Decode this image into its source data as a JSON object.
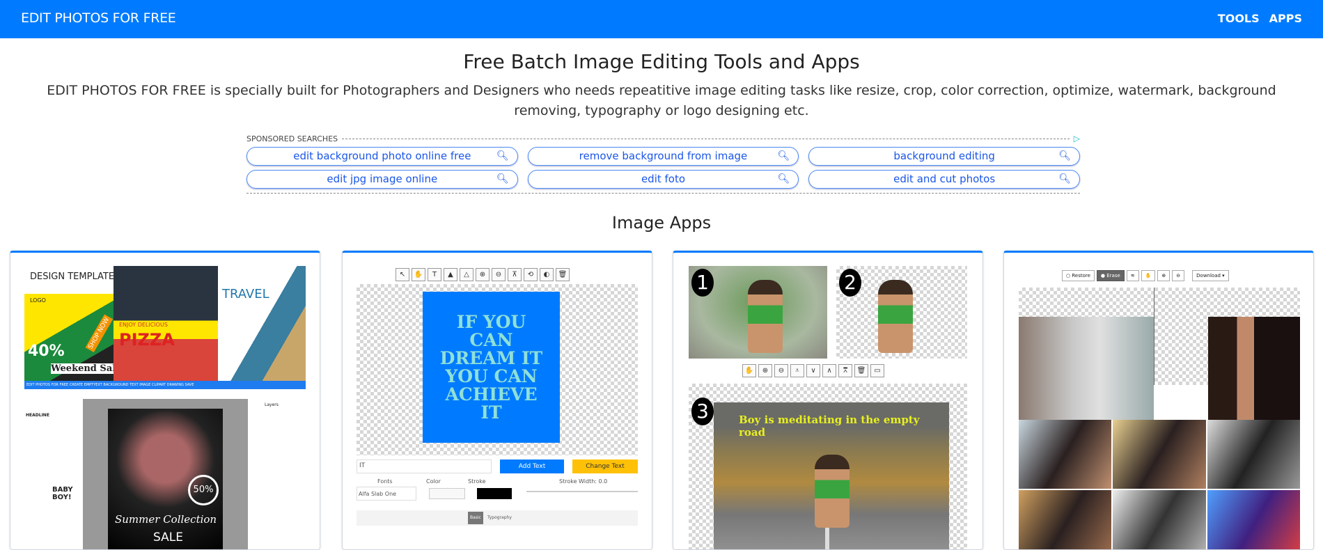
{
  "nav": {
    "brand": "EDIT PHOTOS FOR FREE",
    "links": [
      "TOOLS",
      "APPS"
    ]
  },
  "page": {
    "title": "Free Batch Image Editing Tools and Apps",
    "description": "EDIT PHOTOS FOR FREE is specially built for Photographers and Designers who needs repeatitive image editing tasks like resize, crop, color correction, optimize, watermark, background removing, typography or logo designing etc."
  },
  "ads": {
    "label": "SPONSORED SEARCHES",
    "items": [
      "edit background photo online free",
      "remove background from image",
      "background editing",
      "edit jpg image online",
      "edit foto",
      "edit and cut photos"
    ]
  },
  "section": {
    "title": "Image Apps"
  },
  "card1": {
    "heading": "DESIGN TEMPLATES",
    "logo": "LOGO",
    "pizza": "PIZZA",
    "enjoy": "ENJOY DELICIOUS",
    "travel": "TRAVEL",
    "weekend": "Weekend Sale",
    "pct": "40%",
    "shop": "SHOP NOW",
    "bar": "EDIT PHOTOS FOR FREE   CREATE   EMPTYEXT   BACKGROUND   TEXT   IMAGE   CLIPART   DRAWING   SAVE",
    "headline": "HEADLINE",
    "baby": "BABY BOY!",
    "summer": "Summer Collection",
    "sale": "SALE",
    "off": "50%",
    "layers": "Layers"
  },
  "card2": {
    "art_text": "IF YOU CAN DREAM IT YOU CAN ACHIEVE IT",
    "input_value": "IT",
    "add": "Add Text",
    "change": "Change Text",
    "fonts": "Fonts",
    "color": "Color",
    "stroke": "Stroke",
    "stroke_width": "Stroke Width: 0.0",
    "font_value": "Alfa Slab One",
    "tabs": [
      "Basic",
      "Typography"
    ],
    "accent_blue": "#007bff",
    "accent_yellow": "#ffc107"
  },
  "card3": {
    "numbers": [
      "1",
      "2",
      "3"
    ],
    "caption": "Boy is meditating in the empty road"
  },
  "card4": {
    "restore": "Restore",
    "erase": "Erase",
    "download": "Download"
  }
}
